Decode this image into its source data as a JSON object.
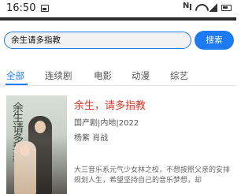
{
  "status_bar": {
    "time": "16:50",
    "icons": [
      "image-icon",
      "mute-icon",
      "wifi-icon",
      "sim-icon",
      "battery-icon"
    ]
  },
  "search": {
    "value": "余生请多指教",
    "button_label": "搜索"
  },
  "tabs": [
    {
      "label": "全部",
      "active": true
    },
    {
      "label": "连续剧",
      "active": false
    },
    {
      "label": "电影",
      "active": false
    },
    {
      "label": "动漫",
      "active": false
    },
    {
      "label": "综艺",
      "active": false
    }
  ],
  "result": {
    "title": "余生，请多指教",
    "meta": "国产剧|内地|2022",
    "cast": "杨紫  肖战",
    "description": "大三音乐系元气少女林之校，不想按照父亲的安排规划人生，希望坚持自己的音乐梦想，却",
    "poster_text": "余生请多指教"
  },
  "colors": {
    "accent": "#1d7af0",
    "title": "#e0342b"
  }
}
